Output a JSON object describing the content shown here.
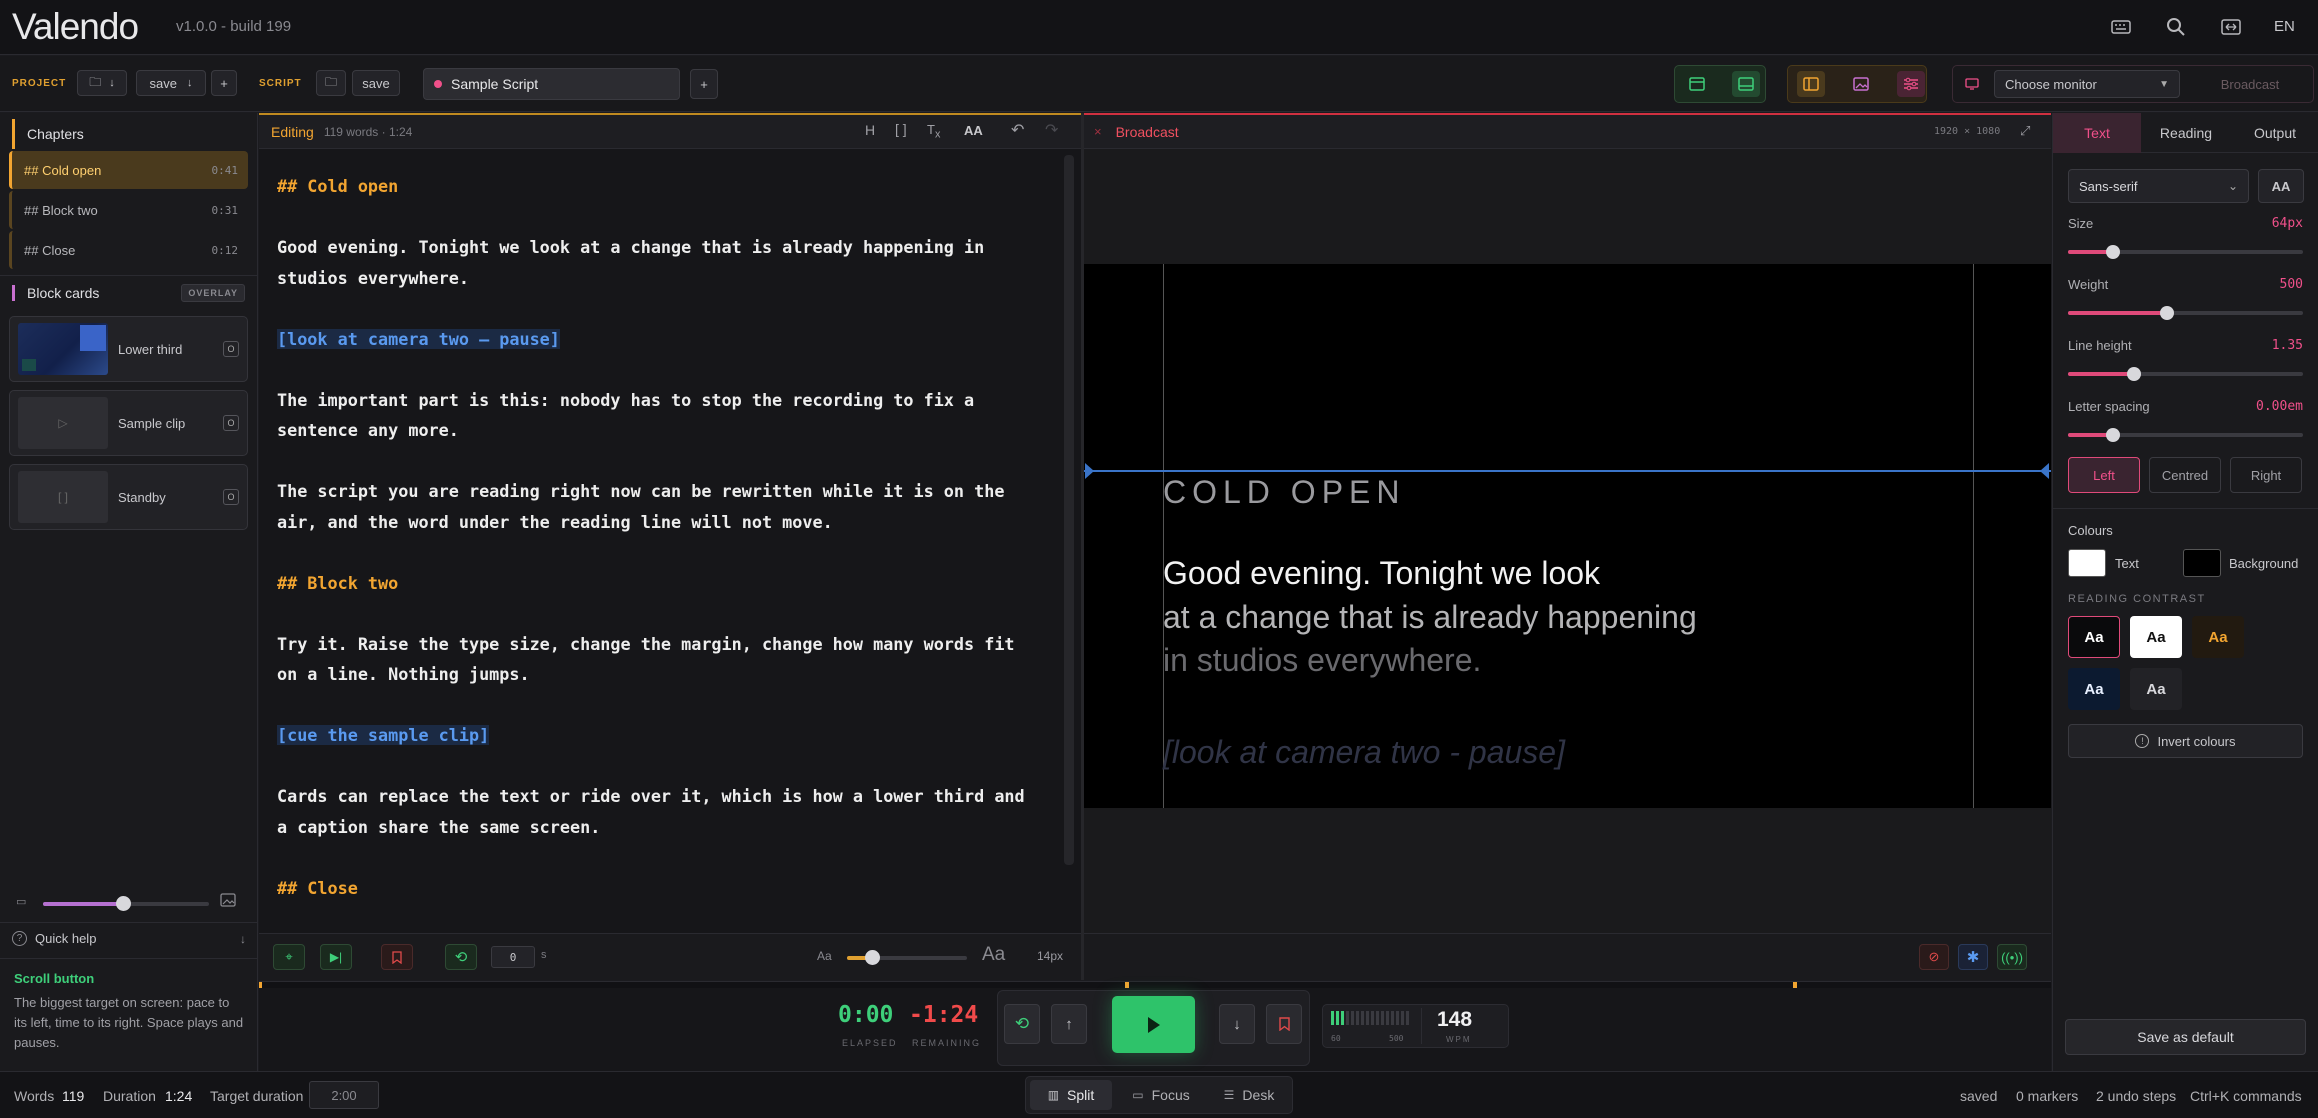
{
  "app": {
    "name": "Valendo",
    "version": "v1.0.0 - build 199",
    "language": "EN"
  },
  "toolbar": {
    "project_label": "PROJECT",
    "project_save": "save",
    "script_label": "SCRIPT",
    "script_save": "save",
    "script_tab": "Sample Script",
    "monitor_select": "Choose monitor",
    "broadcast_button": "Broadcast"
  },
  "sidebar": {
    "chapters_title": "Chapters",
    "chapters": [
      {
        "label": "## Cold open",
        "time": "0:41",
        "active": true
      },
      {
        "label": "## Block two",
        "time": "0:31",
        "active": false
      },
      {
        "label": "## Close",
        "time": "0:12",
        "active": false
      }
    ],
    "cards_title": "Block cards",
    "overlay_badge": "OVERLAY",
    "cards": [
      {
        "name": "Lower third",
        "key": "O"
      },
      {
        "name": "Sample clip",
        "key": "O"
      },
      {
        "name": "Standby",
        "key": "O"
      }
    ],
    "quick_help_title": "Quick help",
    "help_heading": "Scroll button",
    "help_text": "The biggest target on screen: pace to its left, time to its right. Space plays and pauses."
  },
  "editor": {
    "mode": "Editing",
    "meta": "119 words · 1:24",
    "lines": [
      {
        "text": "## Cold open",
        "kind": "hdr"
      },
      {
        "text": "",
        "kind": "blank"
      },
      {
        "text": "Good evening. Tonight we look at a change that is already happening in",
        "kind": "txt"
      },
      {
        "text": "studios everywhere.",
        "kind": "txt"
      },
      {
        "text": "",
        "kind": "blank"
      },
      {
        "text": "[look at camera two – pause]",
        "kind": "cue"
      },
      {
        "text": "",
        "kind": "blank"
      },
      {
        "text": "The important part is this: nobody has to stop the recording to fix a",
        "kind": "txt"
      },
      {
        "text": "sentence any more.",
        "kind": "txt"
      },
      {
        "text": "",
        "kind": "blank"
      },
      {
        "text": "The script you are reading right now can be rewritten while it is on the",
        "kind": "txt"
      },
      {
        "text": "air, and the word under the reading line will not move.",
        "kind": "txt"
      },
      {
        "text": "",
        "kind": "blank"
      },
      {
        "text": "## Block two",
        "kind": "hdr"
      },
      {
        "text": "",
        "kind": "blank"
      },
      {
        "text": "Try it. Raise the type size, change the margin, change how many words fit",
        "kind": "txt"
      },
      {
        "text": "on a line. Nothing jumps.",
        "kind": "txt"
      },
      {
        "text": "",
        "kind": "blank"
      },
      {
        "text": "[cue the sample clip]",
        "kind": "cue"
      },
      {
        "text": "",
        "kind": "blank"
      },
      {
        "text": "Cards can replace the text or ride over it, which is how a lower third and",
        "kind": "txt"
      },
      {
        "text": "a caption share the same screen.",
        "kind": "txt"
      },
      {
        "text": "",
        "kind": "blank"
      },
      {
        "text": "## Close",
        "kind": "hdr"
      }
    ],
    "countdown_value": "0",
    "countdown_unit": "s",
    "font_small": "Aa",
    "font_large": "Aa",
    "font_size": "14px"
  },
  "broadcast": {
    "title": "Broadcast",
    "resolution": "1920 × 1080",
    "heading": "COLD OPEN",
    "line1": "Good evening. Tonight we look",
    "line2": "at a change that is already happening",
    "line3": "in studios everywhere.",
    "cue": "[look at camera two - pause]"
  },
  "settings": {
    "tabs": [
      "Text",
      "Reading",
      "Output"
    ],
    "font": "Sans-serif",
    "case_button": "AA",
    "size_label": "Size",
    "size_value": "64px",
    "size_level": 0.19,
    "weight_label": "Weight",
    "weight_value": "500",
    "weight_level": 0.42,
    "lineheight_label": "Line height",
    "lineheight_value": "1.35",
    "lineheight_level": 0.28,
    "spacing_label": "Letter spacing",
    "spacing_value": "0.00em",
    "spacing_level": 0.19,
    "align": [
      "Left",
      "Centred",
      "Right"
    ],
    "colours_title": "Colours",
    "text_colour_label": "Text",
    "bg_colour_label": "Background",
    "contrast_title": "READING CONTRAST",
    "contrast_sample": "Aa",
    "invert_button": "Invert colours",
    "save_default": "Save as default",
    "accent": "#e04a7a"
  },
  "transport": {
    "elapsed": "0:00",
    "elapsed_label": "ELAPSED",
    "remaining": "-1:24",
    "remaining_label": "REMAINING",
    "pace_min": "60",
    "pace_max": "500",
    "wpm": "148",
    "wpm_label": "WPM"
  },
  "status": {
    "words_label": "Words",
    "words": "119",
    "duration_label": "Duration",
    "duration": "1:24",
    "target_label": "Target duration",
    "target": "2:00",
    "views": [
      "Split",
      "Focus",
      "Desk"
    ],
    "saved": "saved",
    "markers": "0 markers",
    "undo": "2 undo steps",
    "commands": "Ctrl+K commands"
  }
}
